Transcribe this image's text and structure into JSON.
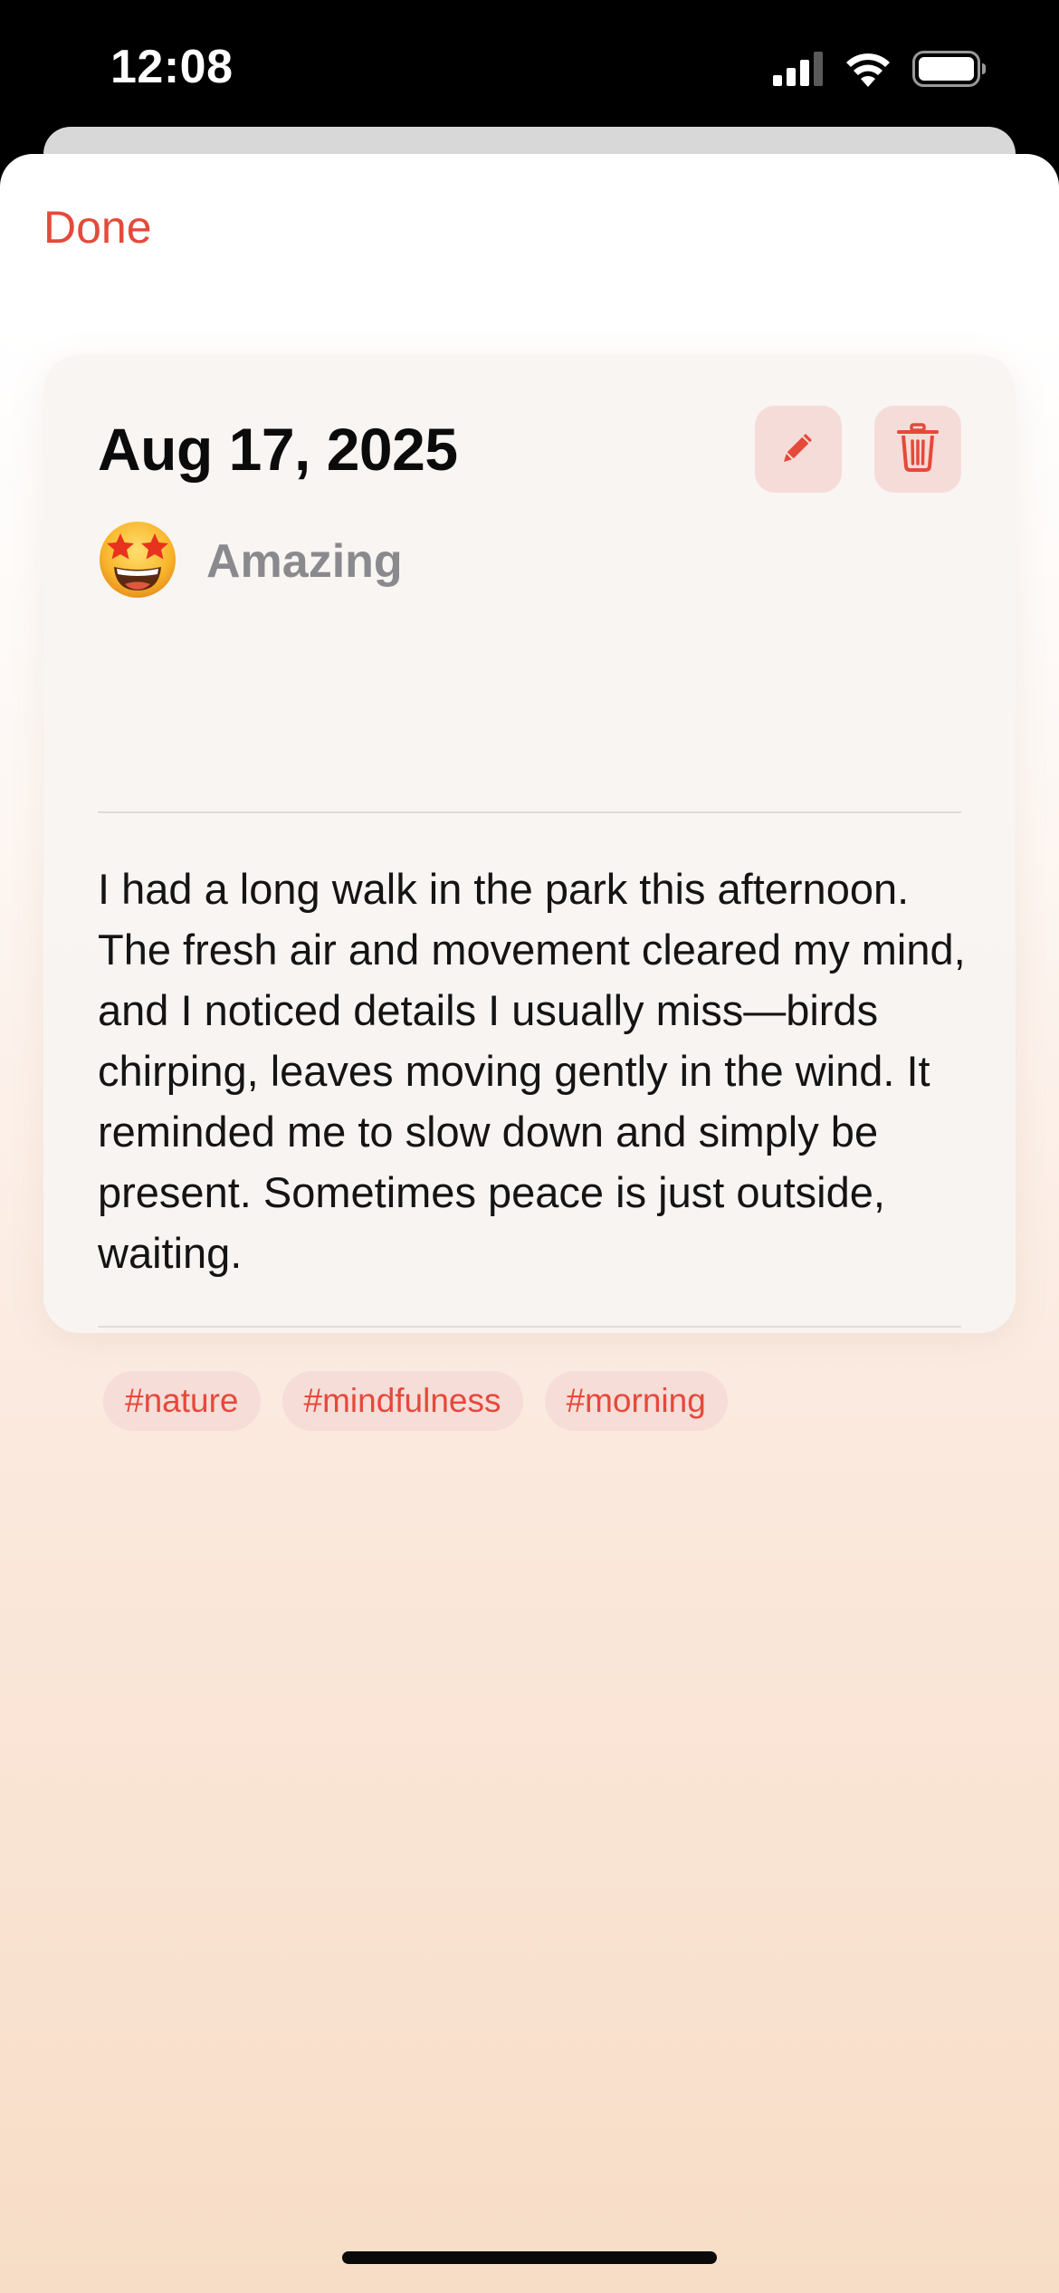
{
  "status_bar": {
    "time": "12:08",
    "icons": [
      "cellular-signal-icon",
      "wifi-icon",
      "battery-icon"
    ]
  },
  "sheet": {
    "done_label": "Done"
  },
  "entry": {
    "date": "Aug 17, 2025",
    "mood": {
      "emoji": "🤩",
      "label": "Amazing"
    },
    "body": "I had a long walk in the park this afternoon. The fresh air and movement cleared my mind, and I noticed details I usually miss—birds chirping, leaves moving gently in the wind. It reminded me to slow down and simply be present. Sometimes peace is just outside, waiting.",
    "tags": [
      "#nature",
      "#mindfulness",
      "#morning"
    ],
    "actions": {
      "edit_icon": "pencil-icon",
      "delete_icon": "trash-icon"
    }
  },
  "colors": {
    "accent": "#e5493a",
    "action_bg": "#f6dcd8",
    "mood_text": "#8a8a8e"
  }
}
